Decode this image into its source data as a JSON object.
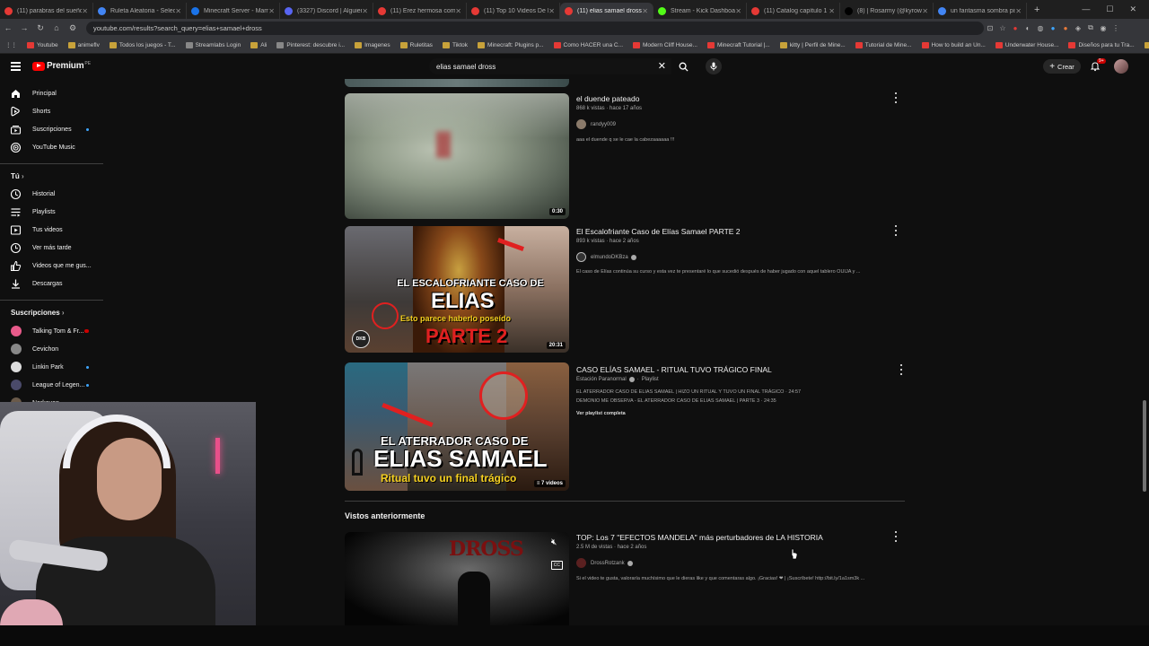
{
  "browser": {
    "tabs": [
      {
        "label": "(11) parabras del sueño -"
      },
      {
        "label": "Ruleta Aleatoria - Selecci"
      },
      {
        "label": "Minecraft Server - Mam"
      },
      {
        "label": "(3327) Discord | Alguien"
      },
      {
        "label": "(11) Erez hermosa como"
      },
      {
        "label": "(11) Top 10 Videos De Mi"
      },
      {
        "label": "(11) elias samael dross -",
        "active": true
      },
      {
        "label": "Stream - Kick Dashboard"
      },
      {
        "label": "(11) Catalog capítulo 1 (1"
      },
      {
        "label": "(8) | Rosarmy (@kyrows"
      },
      {
        "label": "un fantasma sombra piso"
      }
    ],
    "url": "youtube.com/results?search_query=elias+samael+dross",
    "bookmarks": [
      {
        "label": "Youtube",
        "icon": "youtube-icon"
      },
      {
        "label": "animeflv",
        "icon": "folder-icon"
      },
      {
        "label": "Todos los juegos - T...",
        "icon": "folder-icon"
      },
      {
        "label": "Streamlabs Login",
        "icon": "streamlabs-icon"
      },
      {
        "label": "Ali",
        "icon": "folder-icon"
      },
      {
        "label": "Pinterest: descubre i...",
        "icon": "pinterest-icon"
      },
      {
        "label": "Imagenes",
        "icon": "folder-icon"
      },
      {
        "label": "Ruletitas",
        "icon": "folder-icon"
      },
      {
        "label": "Tiktok",
        "icon": "folder-icon"
      },
      {
        "label": "Minecraft: Plugins p...",
        "icon": "folder-icon"
      },
      {
        "label": "Como HACER una C...",
        "icon": "youtube-icon"
      },
      {
        "label": "Modern Cliff House...",
        "icon": "youtube-icon"
      },
      {
        "label": "Minecraft Tutorial |...",
        "icon": "youtube-icon"
      },
      {
        "label": "kitty | Perfil de Mine...",
        "icon": "folder-icon"
      },
      {
        "label": "Tutorial de Mine...",
        "icon": "youtube-icon"
      },
      {
        "label": "How to build an Un...",
        "icon": "youtube-icon"
      },
      {
        "label": "Underwater House...",
        "icon": "youtube-icon"
      },
      {
        "label": "Diseños para tu Tra...",
        "icon": "youtube-icon"
      },
      {
        "label": "Todos los favoritos",
        "icon": "folder-icon"
      }
    ]
  },
  "header": {
    "logo_text": "Premium",
    "logo_superscript": "PE",
    "search_value": "elias samael dross",
    "create_label": "Crear",
    "notif_badge": "9+"
  },
  "sidebar": {
    "main": [
      {
        "label": "Principal",
        "icon": "home-icon"
      },
      {
        "label": "Shorts",
        "icon": "shorts-icon"
      },
      {
        "label": "Suscripciones",
        "icon": "subscriptions-icon"
      },
      {
        "label": "YouTube Music",
        "icon": "music-icon"
      }
    ],
    "you_header": "Tú",
    "you": [
      {
        "label": "Historial",
        "icon": "history-icon"
      },
      {
        "label": "Playlists",
        "icon": "playlist-icon"
      },
      {
        "label": "Tus videos",
        "icon": "video-icon"
      },
      {
        "label": "Ver más tarde",
        "icon": "clock-icon"
      },
      {
        "label": "Videos que me gus...",
        "icon": "thumbs-up-icon"
      },
      {
        "label": "Descargas",
        "icon": "download-icon"
      }
    ],
    "subs_header": "Suscripciones",
    "subs": [
      {
        "label": "Talking Tom & Fr...",
        "color": "#e85a8a"
      },
      {
        "label": "Cevichon",
        "color": "#888888"
      },
      {
        "label": "Linkin Park",
        "color": "#dddddd"
      },
      {
        "label": "League of Legen...",
        "color": "#4a4a6a"
      },
      {
        "label": "Nerkayan",
        "color": "#6a5a4a"
      }
    ]
  },
  "results": [
    {
      "title": "el duende pateado",
      "meta": "868 k vistas · hace 17 años",
      "channel": "randyy009",
      "verified": false,
      "desc": "aaa el duende q se le cae la cabezaaaaaa !!!",
      "duration": "0:30"
    },
    {
      "title": "El Escalofriante Caso de Elías Samael PARTE 2",
      "meta": "893 k vistas · hace 2 años",
      "channel": "elmundoDKBza",
      "verified": true,
      "desc": "El caso de Elías continúa su curso y esta vez te presentaré lo que sucedió después de haber jugado con aquel tablero OUIJA y ...",
      "duration": "20:31",
      "thumb_text1": "EL ESCALOFRIANTE CASO DE",
      "thumb_text2": "ELIAS",
      "thumb_text3": "Esto parece haberlo poseído",
      "thumb_text4": "PARTE 2",
      "thumb_logo": "DKB"
    },
    {
      "title": "CASO ELÍAS SAMAEL - RITUAL TUVO TRÁGICO FINAL",
      "channel": "Estación Paranormal",
      "verified": true,
      "playlist_label": "Playlist",
      "line1": "EL ATERRADOR CASO DE ELIAS SAMAEL | HIZO UN RITUAL Y TUVO UN FINAL TRÁGICO · 24:57",
      "line2": "DEMONIO ME OBSERVA - EL ATERRADOR CASO DE ELIAS SAMAEL | PARTE 3 · 24:35",
      "full_playlist": "Ver playlist completa",
      "duration": "7 videos",
      "thumb_text1": "EL ATERRADOR CASO DE",
      "thumb_text2": "ELIAS SAMAEL",
      "thumb_text3": "Ritual tuvo un final trágico"
    }
  ],
  "previously_watched": {
    "heading": "Vistos anteriormente",
    "title": "TOP: Los 7 \"EFECTOS MANDELA\" más perturbadores de LA HISTORIA",
    "meta": "2.5 M de vistas · hace 2 años",
    "channel": "DrossRotzank",
    "verified": true,
    "desc": "Si el video te gusta, valoraría muchísimo que le dieras like y que comentaras algo. ¡Gracias! ❤ | ¡Suscríbete! http://bit.ly/1a1sm3k ...",
    "thumb_logo": "DROSS",
    "mute_icon": "mute-icon",
    "cc_label": "CC"
  }
}
